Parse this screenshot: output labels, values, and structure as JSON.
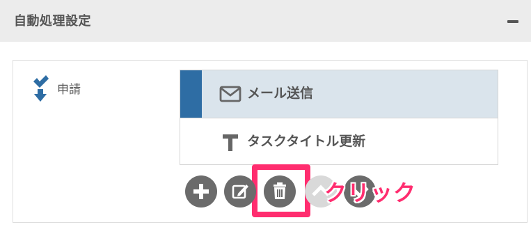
{
  "panel": {
    "title": "自動処理設定",
    "collapse_icon": "minus-icon"
  },
  "trigger": {
    "label": "申請",
    "icon": "check-down-arrow-icon"
  },
  "actions": [
    {
      "label": "メール送信",
      "icon": "envelope-icon",
      "selected": true
    },
    {
      "label": "タスクタイトル更新",
      "icon": "text-t-icon",
      "selected": false
    }
  ],
  "toolbar": {
    "buttons": [
      {
        "name": "add",
        "icon": "plus-icon"
      },
      {
        "name": "edit",
        "icon": "pencil-square-icon"
      },
      {
        "name": "delete",
        "icon": "trash-icon"
      },
      {
        "name": "move-up",
        "icon": "chevron-up-icon",
        "disabled": true
      },
      {
        "name": "move-down",
        "icon": "chevron-down-icon"
      }
    ]
  },
  "annotation": {
    "label": "クリック",
    "color": "#ff2d6f"
  },
  "colors": {
    "accent": "#2e6da4",
    "selected_bg": "#dae4ec",
    "header_bg": "#ececec",
    "button_gray": "#6b6b6b"
  }
}
